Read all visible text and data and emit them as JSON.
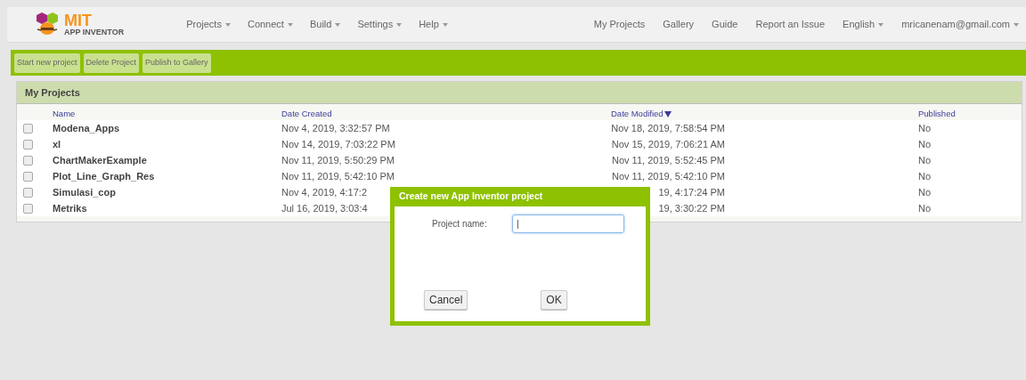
{
  "header": {
    "logo": {
      "title": "MIT",
      "subtitle": "APP INVENTOR"
    },
    "menus": [
      {
        "label": "Projects",
        "dropdown": true
      },
      {
        "label": "Connect",
        "dropdown": true
      },
      {
        "label": "Build",
        "dropdown": true
      },
      {
        "label": "Settings",
        "dropdown": true
      },
      {
        "label": "Help",
        "dropdown": true
      }
    ],
    "links": [
      {
        "label": "My Projects",
        "dropdown": false
      },
      {
        "label": "Gallery",
        "dropdown": false
      },
      {
        "label": "Guide",
        "dropdown": false
      },
      {
        "label": "Report an Issue",
        "dropdown": false
      },
      {
        "label": "English",
        "dropdown": true
      },
      {
        "label": "mricanenam@gmail.com",
        "dropdown": true
      }
    ]
  },
  "toolbar": {
    "buttons": [
      "Start new project",
      "Delete Project",
      "Publish to Gallery"
    ]
  },
  "panel": {
    "title": "My Projects",
    "table": {
      "columns": [
        {
          "label": "Name",
          "sorted": false
        },
        {
          "label": "Date Created",
          "sorted": false
        },
        {
          "label": "Date Modified",
          "sorted": true
        },
        {
          "label": "Published",
          "sorted": false
        }
      ],
      "rows": [
        {
          "checked": false,
          "name": "Modena_Apps",
          "date_created": "Nov 4, 2019, 3:32:57 PM",
          "date_modified": "Nov 18, 2019, 7:58:54 PM",
          "published": "No"
        },
        {
          "checked": false,
          "name": "xl",
          "date_created": "Nov 14, 2019, 7:03:22 PM",
          "date_modified": "Nov 15, 2019, 7:06:21 AM",
          "published": "No"
        },
        {
          "checked": false,
          "name": "ChartMakerExample",
          "date_created": "Nov 11, 2019, 5:50:29 PM",
          "date_modified": "Nov 11, 2019, 5:52:45 PM",
          "published": "No"
        },
        {
          "checked": false,
          "name": "Plot_Line_Graph_Res",
          "date_created": "Nov 11, 2019, 5:42:10 PM",
          "date_modified": "Nov 11, 2019, 5:42:10 PM",
          "published": "No"
        },
        {
          "checked": false,
          "name": "Simulasi_cop",
          "date_created": "Nov 4, 2019, 4:17:2",
          "date_modified": "19, 4:17:24 PM",
          "published": "No"
        },
        {
          "checked": false,
          "name": "Metriks",
          "date_created": "Jul 16, 2019, 3:03:4",
          "date_modified": "19, 3:30:22 PM",
          "published": "No"
        }
      ]
    }
  },
  "dialog": {
    "title": "Create new App Inventor project",
    "field_label": "Project name:",
    "value": "|",
    "buttons": [
      "Cancel",
      "OK"
    ]
  }
}
